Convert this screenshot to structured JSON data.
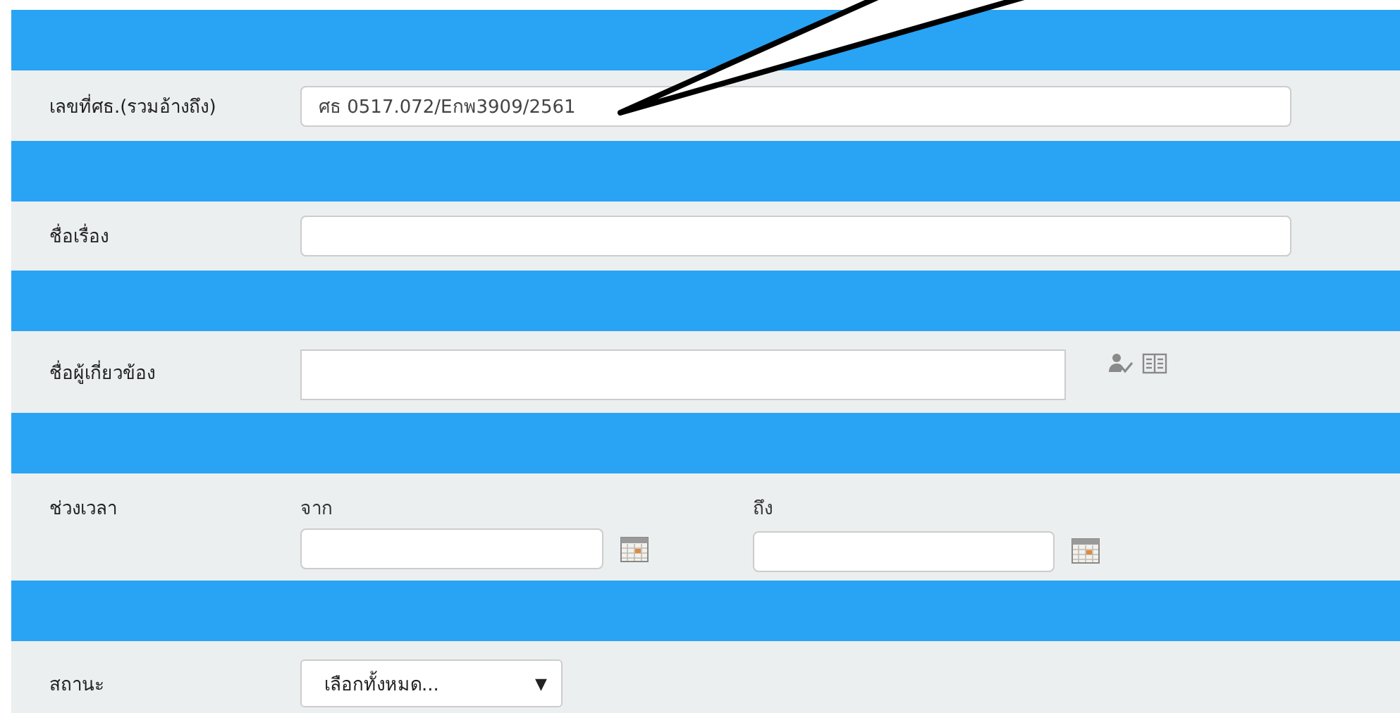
{
  "rows": [
    {
      "kind": "text",
      "label": "เลขที่ศธ.(รวมอ้างถึง)",
      "value": "ศธ 0517.072/Eกพ3909/2561"
    },
    {
      "kind": "text",
      "label": "ชื่อเรื่อง"
    },
    {
      "kind": "people",
      "label": "ชื่อผู้เกี่ยวข้อง"
    },
    {
      "kind": "daterange",
      "label": "ช่วงเวลา",
      "from_label": "จาก",
      "to_label": "ถึง"
    },
    {
      "kind": "select",
      "label": "สถานะ",
      "value": "เลือกทั้งหมด...",
      "caret": "▼"
    }
  ]
}
